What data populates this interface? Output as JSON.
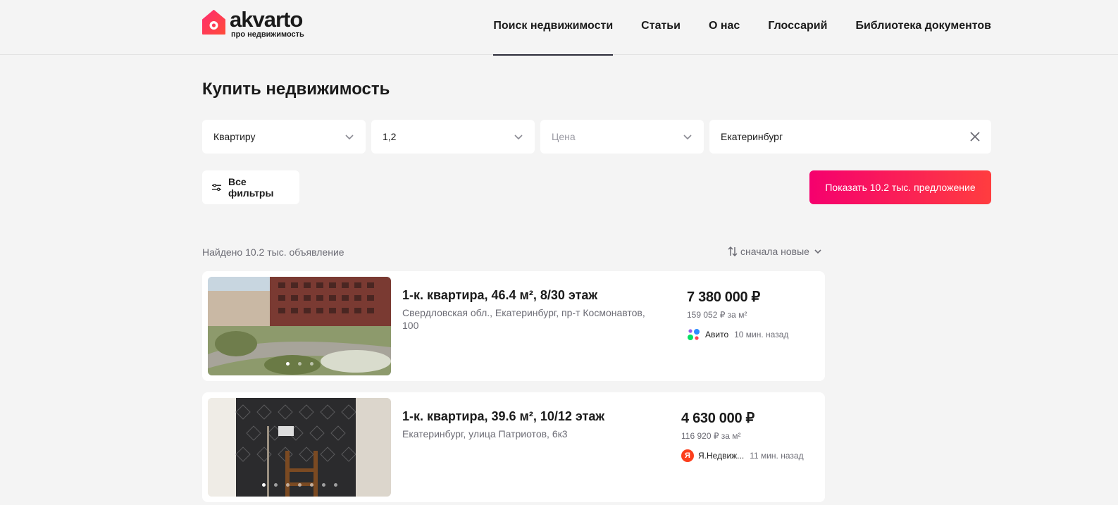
{
  "header": {
    "logo_name": "akvarto",
    "logo_tagline": "про недвижимость",
    "nav": [
      {
        "label": "Поиск недвижимости"
      },
      {
        "label": "Статьи"
      },
      {
        "label": "О нас"
      },
      {
        "label": "Глоссарий"
      },
      {
        "label": "Библиотека документов"
      }
    ]
  },
  "page_title": "Купить недвижимость",
  "filters": {
    "type": "Квартиру",
    "rooms": "1,2",
    "price_placeholder": "Цена",
    "city": "Екатеринбург",
    "all_filters": "Все фильтры",
    "show_button": "Показать 10.2 тыс. предложение"
  },
  "results": {
    "found": "Найдено 10.2 тыс. объявление",
    "sort": "сначала новые"
  },
  "listings": [
    {
      "title": "1-к. квартира, 46.4 м², 8/30 этаж",
      "address": "Свердловская обл., Екатеринбург, пр-т Космонавтов, 100",
      "price": "7 380 000 ₽",
      "price_per_m2": "159 052 ₽ за м²",
      "source": "Авито",
      "time": "10 мин. назад",
      "photo_count": 3,
      "active_photo": 1
    },
    {
      "title": "1-к. квартира, 39.6 м², 10/12 этаж",
      "address": "Екатеринбург, улица Патриотов, 6к3",
      "price": "4 630 000 ₽",
      "price_per_m2": "116 920 ₽ за м²",
      "source": "Я.Недвиж...",
      "time": "11 мин. назад",
      "photo_count": 8,
      "active_photo": 1
    }
  ],
  "colors": {
    "accent_start": "#f5006e",
    "accent_end": "#ff3d3f",
    "background": "#f4f4f4"
  }
}
